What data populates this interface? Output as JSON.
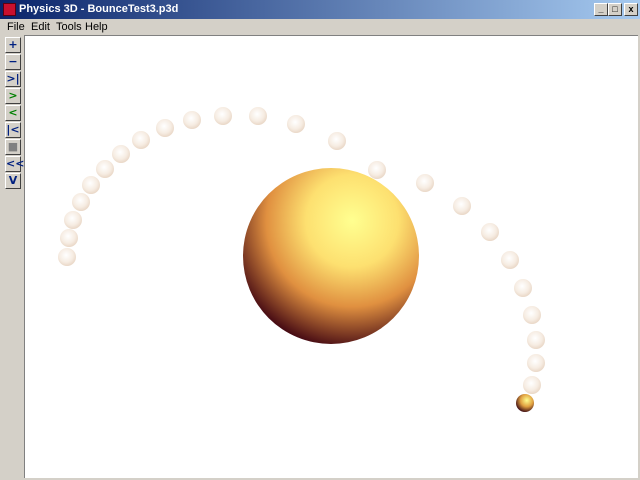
{
  "window": {
    "title": "Physics 3D - BounceTest3.p3d",
    "minimize_label": "_",
    "maximize_label": "□",
    "close_label": "x"
  },
  "menu": [
    "File",
    "Edit",
    "Tools",
    "Help"
  ],
  "toolbar": [
    {
      "name": "zoom-in-button",
      "label": "+",
      "color": "#002080"
    },
    {
      "name": "zoom-out-button",
      "label": "−",
      "color": "#002080"
    },
    {
      "name": "step-to-end-button",
      "label": ">|",
      "color": "#002080"
    },
    {
      "name": "play-forward-button",
      "label": ">",
      "color": "#008000"
    },
    {
      "name": "play-backward-button",
      "label": "<",
      "color": "#008000"
    },
    {
      "name": "step-to-start-button",
      "label": "|<",
      "color": "#002080"
    },
    {
      "name": "stop-button",
      "label": "■",
      "color": "#808080"
    },
    {
      "name": "rewind-button",
      "label": "<<",
      "color": "#002080"
    },
    {
      "name": "view-button",
      "label": "V",
      "color": "#002080"
    }
  ],
  "colors": {
    "sphere_highlight": "#ffff80",
    "sphere_mid": "#f0b060",
    "sphere_shadow": "#500010",
    "ghost_ball": "#f3e6d8"
  }
}
